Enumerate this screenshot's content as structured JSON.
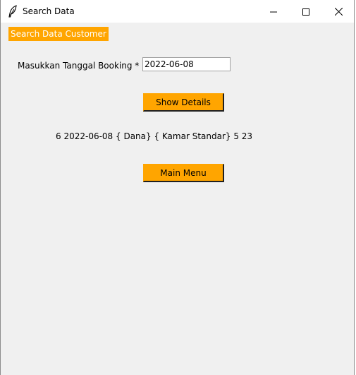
{
  "window": {
    "title": "Search Data",
    "icon": "feather-icon",
    "controls": [
      "minimize-icon",
      "maximize-icon",
      "close-icon"
    ]
  },
  "form": {
    "header": "Search Data Customer",
    "date_label": "Masukkan Tanggal Booking *",
    "date_value": "2022-06-08",
    "show_button": "Show Details",
    "result": "6 2022-06-08 { Dana} { Kamar Standar} 5 23",
    "menu_button": "Main Menu"
  },
  "colors": {
    "accent": "#ffa500",
    "background": "#f0f0f0",
    "titlebar": "#ffffff"
  }
}
